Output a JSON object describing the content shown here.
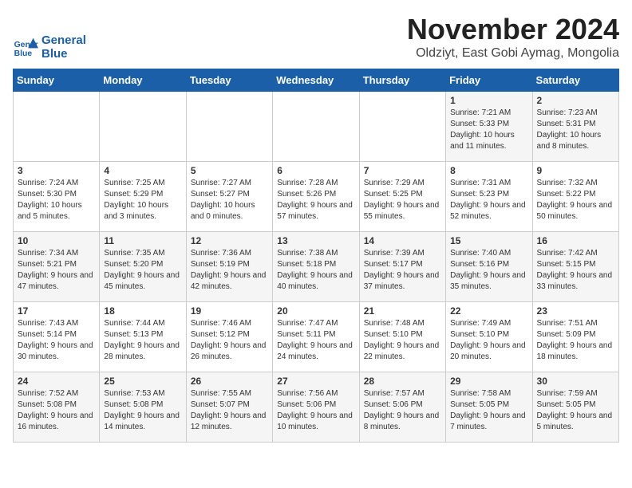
{
  "logo": {
    "text_general": "General",
    "text_blue": "Blue"
  },
  "title": "November 2024",
  "location": "Oldziyt, East Gobi Aymag, Mongolia",
  "days_of_week": [
    "Sunday",
    "Monday",
    "Tuesday",
    "Wednesday",
    "Thursday",
    "Friday",
    "Saturday"
  ],
  "weeks": [
    [
      {
        "day": "",
        "info": ""
      },
      {
        "day": "",
        "info": ""
      },
      {
        "day": "",
        "info": ""
      },
      {
        "day": "",
        "info": ""
      },
      {
        "day": "",
        "info": ""
      },
      {
        "day": "1",
        "info": "Sunrise: 7:21 AM\nSunset: 5:33 PM\nDaylight: 10 hours and 11 minutes."
      },
      {
        "day": "2",
        "info": "Sunrise: 7:23 AM\nSunset: 5:31 PM\nDaylight: 10 hours and 8 minutes."
      }
    ],
    [
      {
        "day": "3",
        "info": "Sunrise: 7:24 AM\nSunset: 5:30 PM\nDaylight: 10 hours and 5 minutes."
      },
      {
        "day": "4",
        "info": "Sunrise: 7:25 AM\nSunset: 5:29 PM\nDaylight: 10 hours and 3 minutes."
      },
      {
        "day": "5",
        "info": "Sunrise: 7:27 AM\nSunset: 5:27 PM\nDaylight: 10 hours and 0 minutes."
      },
      {
        "day": "6",
        "info": "Sunrise: 7:28 AM\nSunset: 5:26 PM\nDaylight: 9 hours and 57 minutes."
      },
      {
        "day": "7",
        "info": "Sunrise: 7:29 AM\nSunset: 5:25 PM\nDaylight: 9 hours and 55 minutes."
      },
      {
        "day": "8",
        "info": "Sunrise: 7:31 AM\nSunset: 5:23 PM\nDaylight: 9 hours and 52 minutes."
      },
      {
        "day": "9",
        "info": "Sunrise: 7:32 AM\nSunset: 5:22 PM\nDaylight: 9 hours and 50 minutes."
      }
    ],
    [
      {
        "day": "10",
        "info": "Sunrise: 7:34 AM\nSunset: 5:21 PM\nDaylight: 9 hours and 47 minutes."
      },
      {
        "day": "11",
        "info": "Sunrise: 7:35 AM\nSunset: 5:20 PM\nDaylight: 9 hours and 45 minutes."
      },
      {
        "day": "12",
        "info": "Sunrise: 7:36 AM\nSunset: 5:19 PM\nDaylight: 9 hours and 42 minutes."
      },
      {
        "day": "13",
        "info": "Sunrise: 7:38 AM\nSunset: 5:18 PM\nDaylight: 9 hours and 40 minutes."
      },
      {
        "day": "14",
        "info": "Sunrise: 7:39 AM\nSunset: 5:17 PM\nDaylight: 9 hours and 37 minutes."
      },
      {
        "day": "15",
        "info": "Sunrise: 7:40 AM\nSunset: 5:16 PM\nDaylight: 9 hours and 35 minutes."
      },
      {
        "day": "16",
        "info": "Sunrise: 7:42 AM\nSunset: 5:15 PM\nDaylight: 9 hours and 33 minutes."
      }
    ],
    [
      {
        "day": "17",
        "info": "Sunrise: 7:43 AM\nSunset: 5:14 PM\nDaylight: 9 hours and 30 minutes."
      },
      {
        "day": "18",
        "info": "Sunrise: 7:44 AM\nSunset: 5:13 PM\nDaylight: 9 hours and 28 minutes."
      },
      {
        "day": "19",
        "info": "Sunrise: 7:46 AM\nSunset: 5:12 PM\nDaylight: 9 hours and 26 minutes."
      },
      {
        "day": "20",
        "info": "Sunrise: 7:47 AM\nSunset: 5:11 PM\nDaylight: 9 hours and 24 minutes."
      },
      {
        "day": "21",
        "info": "Sunrise: 7:48 AM\nSunset: 5:10 PM\nDaylight: 9 hours and 22 minutes."
      },
      {
        "day": "22",
        "info": "Sunrise: 7:49 AM\nSunset: 5:10 PM\nDaylight: 9 hours and 20 minutes."
      },
      {
        "day": "23",
        "info": "Sunrise: 7:51 AM\nSunset: 5:09 PM\nDaylight: 9 hours and 18 minutes."
      }
    ],
    [
      {
        "day": "24",
        "info": "Sunrise: 7:52 AM\nSunset: 5:08 PM\nDaylight: 9 hours and 16 minutes."
      },
      {
        "day": "25",
        "info": "Sunrise: 7:53 AM\nSunset: 5:08 PM\nDaylight: 9 hours and 14 minutes."
      },
      {
        "day": "26",
        "info": "Sunrise: 7:55 AM\nSunset: 5:07 PM\nDaylight: 9 hours and 12 minutes."
      },
      {
        "day": "27",
        "info": "Sunrise: 7:56 AM\nSunset: 5:06 PM\nDaylight: 9 hours and 10 minutes."
      },
      {
        "day": "28",
        "info": "Sunrise: 7:57 AM\nSunset: 5:06 PM\nDaylight: 9 hours and 8 minutes."
      },
      {
        "day": "29",
        "info": "Sunrise: 7:58 AM\nSunset: 5:05 PM\nDaylight: 9 hours and 7 minutes."
      },
      {
        "day": "30",
        "info": "Sunrise: 7:59 AM\nSunset: 5:05 PM\nDaylight: 9 hours and 5 minutes."
      }
    ]
  ]
}
